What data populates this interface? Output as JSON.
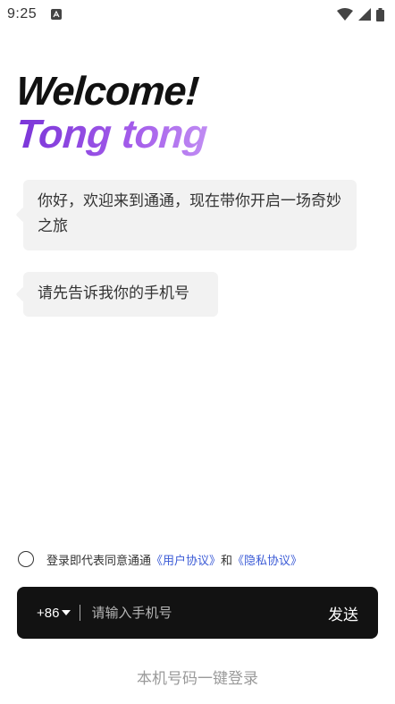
{
  "status_bar": {
    "time": "9:25",
    "app_icon": "android-notification-icon",
    "icons": [
      "wifi-icon",
      "signal-icon",
      "battery-icon"
    ]
  },
  "header": {
    "welcome": "Welcome!",
    "brand": "Tong tong",
    "brand_gradient": [
      "#7a35d8",
      "#c08cf3"
    ]
  },
  "chat": {
    "messages": [
      "你好，欢迎来到通通，现在带你开启一场奇妙之旅",
      "请先告诉我你的手机号"
    ]
  },
  "agreement": {
    "prefix": "登录即代表同意通通",
    "user_agreement": "《用户协议》",
    "joiner": "和",
    "privacy_policy": "《隐私协议》",
    "link_color": "#3b5bd6"
  },
  "phone_form": {
    "country_code": "+86",
    "placeholder": "请输入手机号",
    "value": "",
    "send_label": "发送"
  },
  "one_click_login": "本机号码一键登录"
}
